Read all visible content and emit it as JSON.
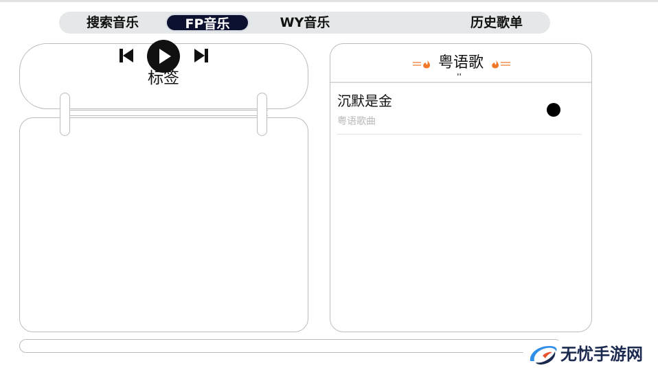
{
  "tabs": {
    "search": "搜索音乐",
    "fp": "FP音乐",
    "wy": "WY音乐",
    "history": "历史歌单",
    "active": "fp",
    "active_bg": "#0d1130"
  },
  "player": {
    "tag_label": "标签",
    "controls": [
      "skip-previous-icon",
      "play-icon",
      "skip-next-icon"
    ]
  },
  "playlist": {
    "title": "粤语歌",
    "decoration_color": "#f07a2a",
    "songs": [
      {
        "title": "沉默是金",
        "subtitle": "粤语歌曲"
      }
    ]
  },
  "watermark": {
    "text": "无忧手游网",
    "colors": [
      "#1c2a4f",
      "#2f8ee8",
      "#e8532c"
    ]
  }
}
